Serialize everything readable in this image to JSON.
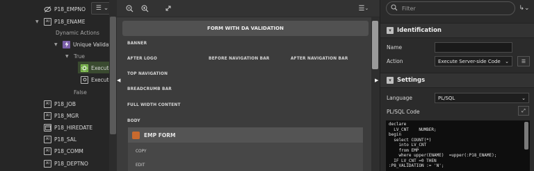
{
  "tree": {
    "toggle_label": "☰",
    "items": [
      {
        "label": "P18_EMPNO",
        "icon": "hidden-item-icon"
      },
      {
        "label": "P18_ENAME",
        "icon": "text-field-icon"
      },
      {
        "label": "Dynamic Actions",
        "icon": ""
      },
      {
        "label": "Unique Validati",
        "icon": "dynamic-action-icon"
      },
      {
        "label": "True",
        "icon": ""
      },
      {
        "label": "Execute",
        "icon": "execute-code-icon"
      },
      {
        "label": "Execute",
        "icon": "execute-code-icon"
      },
      {
        "label": "False",
        "icon": ""
      },
      {
        "label": "P18_JOB",
        "icon": "text-field-icon"
      },
      {
        "label": "P18_MGR",
        "icon": "text-field-icon"
      },
      {
        "label": "P18_HIREDATE",
        "icon": "date-picker-icon"
      },
      {
        "label": "P18_SAL",
        "icon": "text-field-icon"
      },
      {
        "label": "P18_COMM",
        "icon": "text-field-icon"
      },
      {
        "label": "P18_DEPTNO",
        "icon": "text-field-icon"
      }
    ]
  },
  "center": {
    "form_title": "FORM WITH DA VALIDATION",
    "regions": {
      "banner": "BANNER",
      "after_logo": "AFTER LOGO",
      "before_nav": "BEFORE NAVIGATION BAR",
      "after_nav": "AFTER NAVIGATION BAR",
      "top_nav": "TOP NAVIGATION",
      "breadcrumb": "BREADCRUMB BAR",
      "full_width": "FULL WIDTH CONTENT",
      "body": "BODY"
    },
    "emp_form": {
      "title": "EMP FORM",
      "items": [
        "COPY",
        "EDIT"
      ]
    }
  },
  "props": {
    "filter_placeholder": "Filter",
    "sections": {
      "identification": "Identification",
      "settings": "Settings"
    },
    "name_label": "Name",
    "name_value": "",
    "action_label": "Action",
    "action_value": "Execute Server-side Code",
    "language_label": "Language",
    "language_value": "PL/SQL",
    "code_label": "PL/SQL Code",
    "code": "declare\n  LV_CNT    NUMBER;\nbegin\n  select COUNT(*)\n    into LV_CNT\n    from EMP\n    where upper(ENAME)  =upper(:P18_ENAME);\n  IF LV_CNT =0 THEN\n:P8_VALIDATION := 'N';"
  },
  "colors": {
    "selected_icon": "#5b9a2e",
    "emp_icon": "#c86a2e"
  }
}
